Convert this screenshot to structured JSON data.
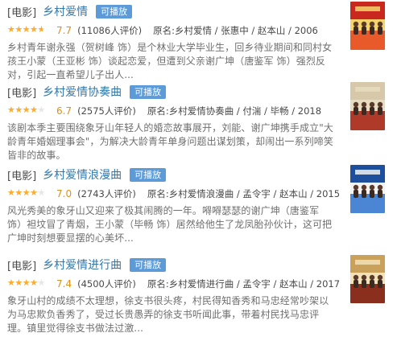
{
  "results": [
    {
      "category": "[电影]",
      "title": "乡村爱情",
      "play_label": "可播放",
      "rating": "7.7",
      "rating_fraction": 0.77,
      "count": "(11086人评价)",
      "info": "原名:乡村爱情 / 张惠中 / 赵本山 / 2006",
      "desc": "乡村青年谢永强（贺树峰 饰）是个林业大学毕业生，回乡待业期间和同村女孩王小蒙（王亚彬 饰）谈起恋爱，但遭到父亲谢广坤（唐鉴军 饰）强烈反对，引起一直希望儿子出人...",
      "poster_colors": [
        "#c8281e",
        "#e85a2a",
        "#f4d36b"
      ]
    },
    {
      "category": "[电影]",
      "title": "乡村爱情协奏曲",
      "play_label": "可播放",
      "rating": "6.7",
      "rating_fraction": 0.67,
      "count": "(2575人评价)",
      "info": "原名:乡村爱情协奏曲 / 付湍 / 毕畅 / 2018",
      "desc": "该剧本季主要围绕象牙山年轻人的婚恋故事展开，刘能、谢广坤携手成立\"大龄青年婚姻理事会\"，为解决大龄青年单身问题出谋划策，却闹出一系列啼笑皆非的故事。",
      "poster_colors": [
        "#d6c8a8",
        "#b03a2a",
        "#e8dcc0"
      ]
    },
    {
      "category": "[电影]",
      "title": "乡村爱情浪漫曲",
      "play_label": "可播放",
      "rating": "7.0",
      "rating_fraction": 0.7,
      "count": "(2743人评价)",
      "info": "原名:乡村爱情浪漫曲 / 孟令宇 / 赵本山 / 2015",
      "desc": "风光秀美的象牙山又迎来了极其闹腾的一年。嘚嘚瑟瑟的谢广坤（唐鉴军 饰）袒坟冒了青烟，王小蒙（毕畅 饰）居然给他生了龙凤胎孙伙计，这可把广坤时刻想要显摆的心美坏...",
      "poster_colors": [
        "#1e4f9c",
        "#4a86d4",
        "#f2f2f2"
      ]
    },
    {
      "category": "[电影]",
      "title": "乡村爱情进行曲",
      "play_label": "可播放",
      "rating": "7.4",
      "rating_fraction": 0.74,
      "count": "(4500人评价)",
      "info": "原名:乡村爱情进行曲 / 孟令宇 / 赵本山 / 2017",
      "desc": "象牙山村的成绩不太理想，徐支书很头疼，村民得知香秀和马忠经常吵架以为马忠欺负香秀了，受过长贵愚弄的徐支书听闻此事，带着村民找马忠评理。镇里觉得徐支书做法过激...",
      "poster_colors": [
        "#caa15a",
        "#8a2e1e",
        "#f3e2b8"
      ]
    }
  ]
}
